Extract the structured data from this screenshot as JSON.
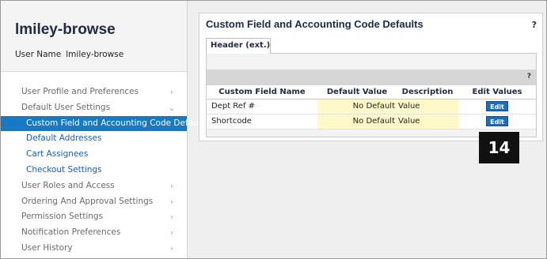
{
  "sidebar": {
    "title": "lmiley-browse",
    "user_label": "User Name",
    "user_value": "lmiley-browse",
    "items": [
      {
        "label": "User Profile and Preferences",
        "type": "section",
        "chevron": "›"
      },
      {
        "label": "Default User Settings",
        "type": "section",
        "chevron": "⌄"
      },
      {
        "label": "Custom Field and Accounting Code Defaults",
        "type": "active"
      },
      {
        "label": "Default Addresses",
        "type": "sub"
      },
      {
        "label": "Cart Assignees",
        "type": "sub"
      },
      {
        "label": "Checkout Settings",
        "type": "sub"
      },
      {
        "label": "User Roles and Access",
        "type": "section",
        "chevron": "›"
      },
      {
        "label": "Ordering And Approval Settings",
        "type": "section",
        "chevron": "›"
      },
      {
        "label": "Permission Settings",
        "type": "section",
        "chevron": "›"
      },
      {
        "label": "Notification Preferences",
        "type": "section",
        "chevron": "›"
      },
      {
        "label": "User History",
        "type": "section",
        "chevron": "›"
      }
    ]
  },
  "panel": {
    "title": "Custom Field and Accounting Code Defaults",
    "help": "?",
    "tab_label": "Header (ext.)",
    "bar_help": "?",
    "table": {
      "headers": [
        "Custom Field Name",
        "Default Value",
        "Description",
        "Edit Values"
      ],
      "rows": [
        {
          "name": "Dept Ref #",
          "default_left": "No Default",
          "default_right": "Value",
          "edit": "Edit"
        },
        {
          "name": "Shortcode",
          "default_left": "No Default",
          "default_right": "Value",
          "edit": "Edit"
        }
      ]
    }
  },
  "step_badge": "14",
  "colors": {
    "active_bg": "#1779c1",
    "link": "#1a5fb4",
    "title": "#1f2a44",
    "highlight": "#fff9c9",
    "edit_button": "#1a6fbb",
    "badge": "#111111"
  }
}
